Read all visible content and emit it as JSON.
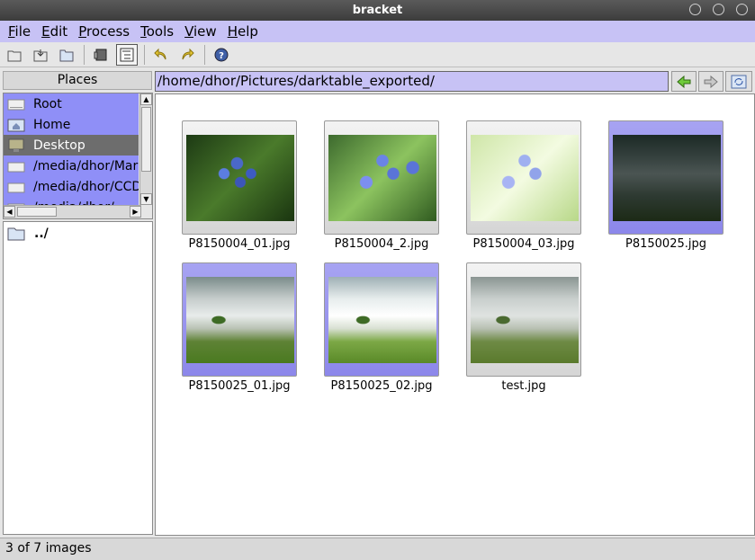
{
  "window": {
    "title": "bracket"
  },
  "menu": [
    {
      "key": "F",
      "rest": "ile"
    },
    {
      "key": "E",
      "rest": "dit"
    },
    {
      "key": "P",
      "rest": "rocess"
    },
    {
      "key": "T",
      "rest": "ools"
    },
    {
      "key": "V",
      "rest": "iew"
    },
    {
      "key": "H",
      "rest": "elp"
    }
  ],
  "places": {
    "header": "Places",
    "items": [
      {
        "label": "Root"
      },
      {
        "label": "Home"
      },
      {
        "label": "Desktop"
      },
      {
        "label": "/media/dhor/Mar"
      },
      {
        "label": "/media/dhor/CCD"
      },
      {
        "label": "/media/dhor/..."
      }
    ]
  },
  "folders": [
    {
      "label": "../"
    }
  ],
  "path": "/home/dhor/Pictures/darktable_exported/",
  "images": [
    {
      "name": "P8150004_01.jpg",
      "selected": false
    },
    {
      "name": "P8150004_2.jpg",
      "selected": false
    },
    {
      "name": "P8150004_03.jpg",
      "selected": false
    },
    {
      "name": "P8150025.jpg",
      "selected": true
    },
    {
      "name": "P8150025_01.jpg",
      "selected": true
    },
    {
      "name": "P8150025_02.jpg",
      "selected": true
    },
    {
      "name": "test.jpg",
      "selected": false
    }
  ],
  "status": "3 of 7 images",
  "colors": {
    "accent": "#c7c2f5",
    "selection": "#8f8ff7",
    "selected_dark": "#6d6d6d"
  }
}
